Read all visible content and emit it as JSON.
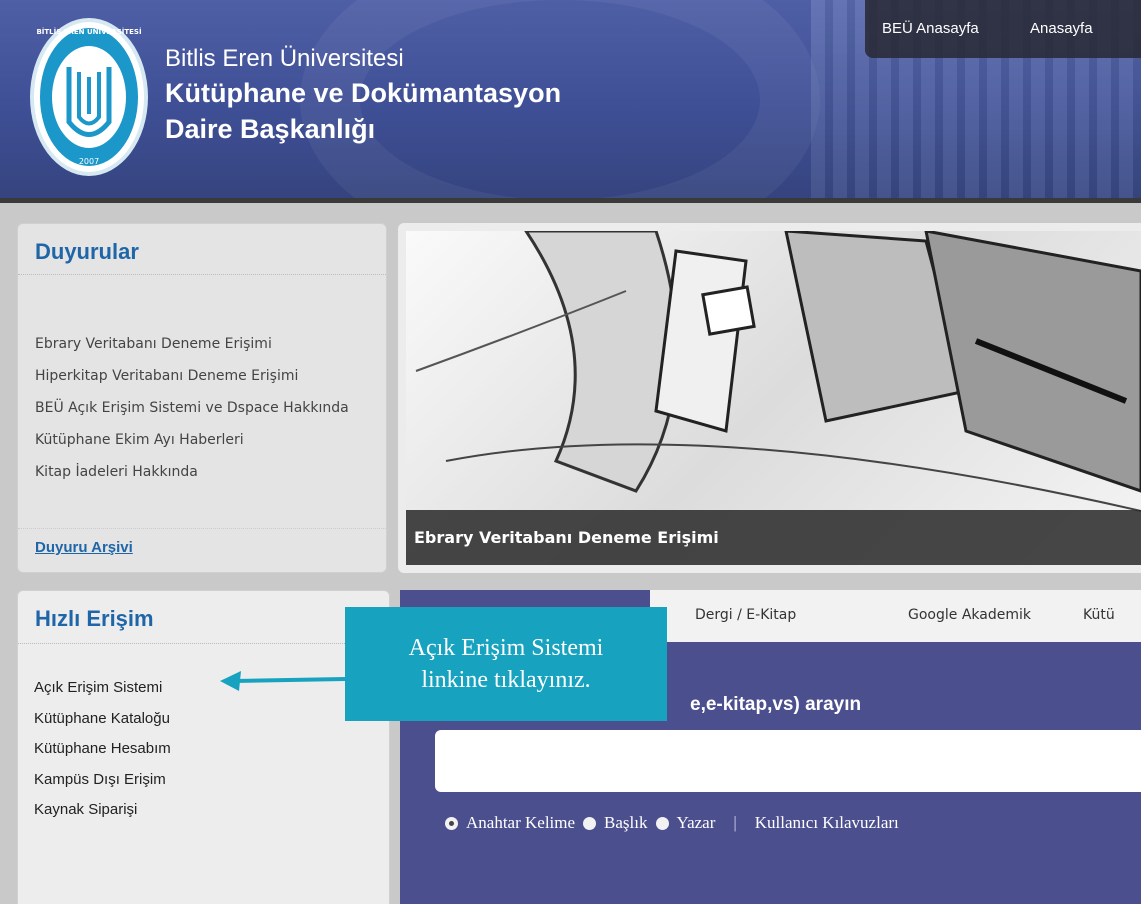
{
  "header": {
    "university": "Bitlis Eren Üniversitesi",
    "department_line1": "Kütüphane ve Dokümantasyon",
    "department_line2": "Daire Başkanlığı",
    "logo_text_top": "BİTLİS EREN ÜNİVERSİTESİ",
    "logo_year": "2007",
    "nav": [
      "BEÜ Anasayfa",
      "Anasayfa"
    ]
  },
  "announcements": {
    "title": "Duyurular",
    "items": [
      "Ebrary Veritabanı Deneme Erişimi",
      "Hiperkitap Veritabanı Deneme Erişimi",
      "BEÜ Açık Erişim Sistemi ve Dspace Hakkında",
      "Kütüphane Ekim Ayı Haberleri",
      "Kitap İadeleri Hakkında"
    ],
    "archive": "Duyuru Arşivi"
  },
  "slider": {
    "caption": "Ebrary Veritabanı Deneme Erişimi"
  },
  "quick_access": {
    "title": "Hızlı Erişim",
    "items": [
      "Açık Erişim Sistemi",
      "Kütüphane Kataloğu",
      "Kütüphane Hesabım",
      "Kampüs Dışı Erişim",
      "Kaynak Siparişi"
    ]
  },
  "search": {
    "tabs": [
      "Dergi / E-Kitap",
      "Google Akademik",
      "Kütü"
    ],
    "label": "e,e-kitap,vs) arayın",
    "options": [
      "Anahtar Kelime",
      "Başlık",
      "Yazar"
    ],
    "guide_link": "Kullanıcı Kılavuzları"
  },
  "callout": {
    "line1": "Açık Erişim Sistemi",
    "line2": "linkine tıklayınız.",
    "color": "#17a3bf"
  }
}
